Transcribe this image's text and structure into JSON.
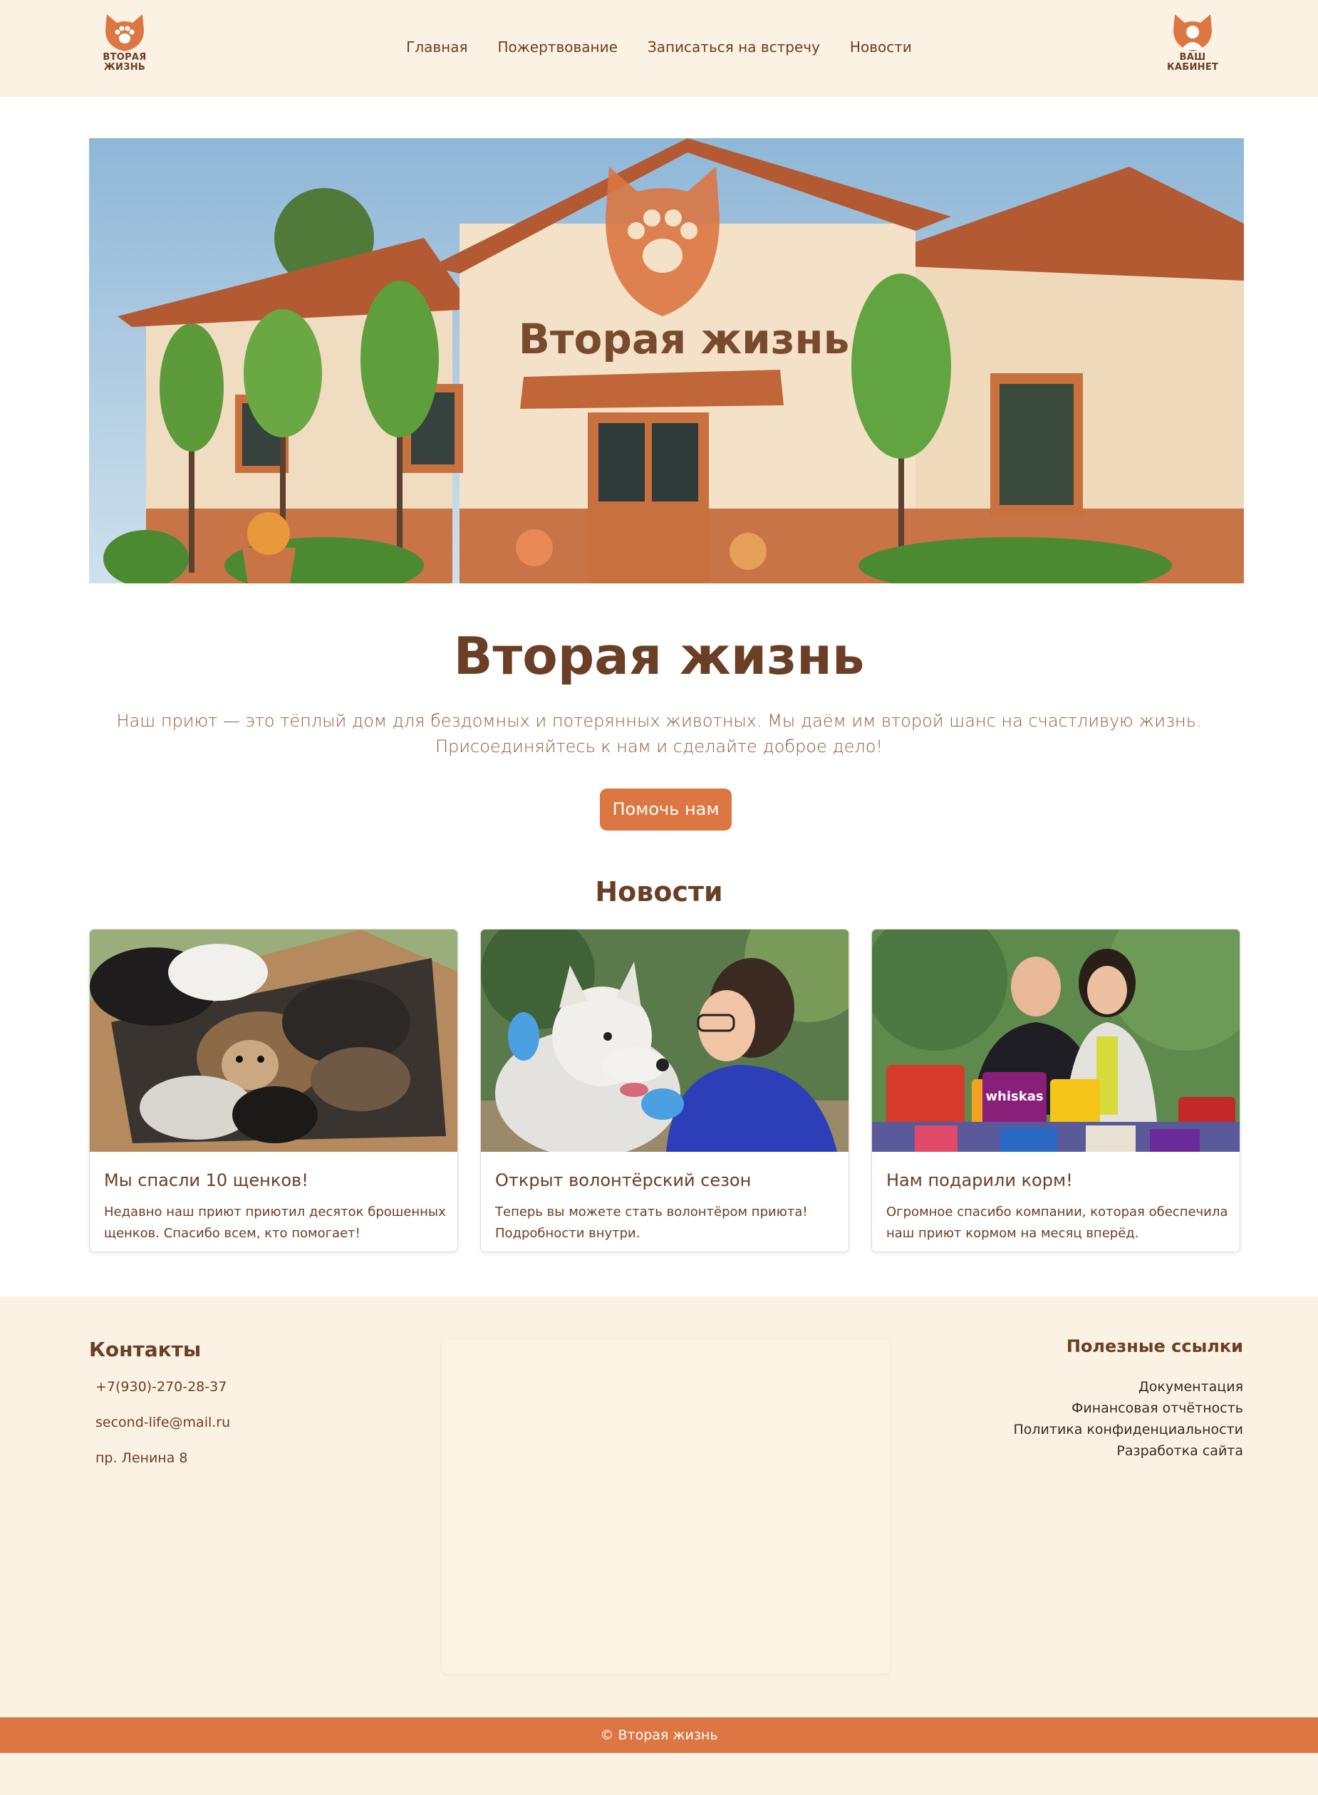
{
  "header": {
    "logo_text": "ВТОРАЯ\nЖИЗНЬ",
    "nav": [
      "Главная",
      "Пожертвование",
      "Записаться на встречу",
      "Новости"
    ],
    "cabinet_text": "ВАШ\nКАБИНЕТ"
  },
  "hero": {
    "sign_text": "Вторая жизнь",
    "title": "Вторая жизнь",
    "lead": "Наш приют — это тёплый дом для бездомных и потерянных животных. Мы даём им второй шанс на счастливую жизнь. Присоединяйтесь к нам и сделайте доброе дело!",
    "button": "Помочь нам"
  },
  "news": {
    "title": "Новости",
    "items": [
      {
        "title": "Мы спасли 10 щенков!",
        "text": "Недавно наш приют приютил десяток брошенных щенков. Спасибо всем, кто помогает!"
      },
      {
        "title": "Открыт волонтёрский сезон",
        "text": "Теперь вы можете стать волонтёром приюта! Подробности внутри."
      },
      {
        "title": "Нам подарили корм!",
        "text": "Огромное спасибо компании, которая обеспечила наш приют кормом на месяц вперёд."
      }
    ],
    "bag_label": "whiskas"
  },
  "footer": {
    "contacts_title": "Контакты",
    "phone": "+7(930)-270-28-37",
    "email": "second-life@mail.ru",
    "address": "пр. Ленина 8",
    "links_title": "Полезные ссылки",
    "links": [
      "Документация",
      "Финансовая отчётность",
      "Политика конфиденциальности",
      "Разработка сайта"
    ],
    "copyright": "© Вторая жизнь"
  },
  "colors": {
    "accent": "#dc7642",
    "brown": "#6b3e26",
    "cream": "#fbf2e3"
  }
}
